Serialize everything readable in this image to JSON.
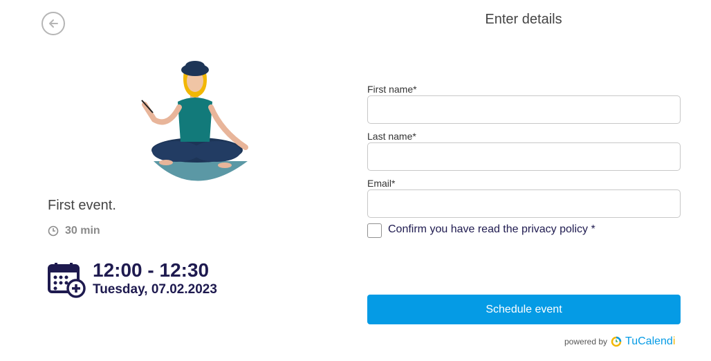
{
  "left_panel": {
    "event_title": "First event.",
    "duration": "30 min",
    "time_range": "12:00 - 12:30",
    "date": "Tuesday, 07.02.2023"
  },
  "form": {
    "heading": "Enter details",
    "first_name_label": "First name*",
    "last_name_label": "Last name*",
    "email_label": "Email*",
    "first_name_value": "",
    "last_name_value": "",
    "email_value": "",
    "privacy_label": "Confirm you have read the privacy policy *",
    "privacy_checked": false,
    "submit_label": "Schedule event"
  },
  "footer": {
    "powered_by": "powered by",
    "brand_part1": "TuCalend",
    "brand_part2": "i"
  },
  "colors": {
    "accent": "#059be5",
    "heading_dark": "#1e1a4f",
    "brand_yellow": "#f2b705"
  },
  "icons": [
    "back-arrow-icon",
    "clock-icon",
    "calendar-add-icon",
    "tucalendi-logo-icon"
  ]
}
